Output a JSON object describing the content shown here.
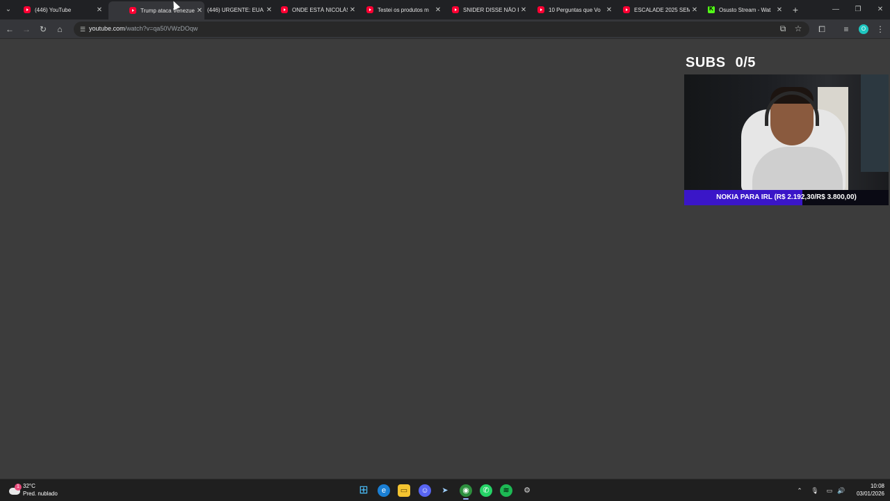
{
  "tabs": [
    {
      "title": "(446) YouTube",
      "favicon": "youtube-icon",
      "active": false
    },
    {
      "title": "Trump ataca Venezuela",
      "favicon": "youtube-icon",
      "active": true
    },
    {
      "title": "(446) URGENTE: EUA",
      "favicon": "none",
      "active": false
    },
    {
      "title": "ONDE ESTÁ NICOLÁS",
      "favicon": "youtube-icon",
      "active": false
    },
    {
      "title": "Testei os produtos m",
      "favicon": "youtube-icon",
      "active": false
    },
    {
      "title": "SNIDER DISSE NÃO F",
      "favicon": "youtube-icon",
      "active": false
    },
    {
      "title": "10 Perguntas que Vo",
      "favicon": "youtube-icon",
      "active": false
    },
    {
      "title": "ESCALADE 2025 SEM",
      "favicon": "youtube-icon",
      "active": false
    },
    {
      "title": "Osusto Stream - Wat",
      "favicon": "kick-icon",
      "active": false
    }
  ],
  "address_bar": {
    "domain": "youtube.com",
    "path": "/watch?v=qa50VWzDOqw"
  },
  "profile_initial": "O",
  "overlay": {
    "subs_label": "SUBS",
    "subs_count": "0/5",
    "goal_text": "NOKIA PARA IRL (R$ 2.192,30/R$ 3.800,00)",
    "goal_progress": 0.577,
    "goal_fill_color": "#3a16c8"
  },
  "weather": {
    "temp": "32°C",
    "condition": "Pred. nublado",
    "badge": "1"
  },
  "taskbar_apps": [
    "windows-start-icon",
    "edge-icon",
    "file-explorer-icon",
    "discord-icon",
    "steam-icon",
    "chrome-icon",
    "whatsapp-icon",
    "spotify-icon",
    "settings-icon"
  ],
  "clock": {
    "time": "10:08",
    "date": "03/01/2026"
  },
  "colors": {
    "page_bg": "#3c3c3c",
    "tabstrip_bg": "#202124",
    "toolbar_bg": "#35363a",
    "taskbar_bg": "#1f1f1f",
    "youtube_red": "#ff0033",
    "kick_green": "#53fc18"
  }
}
